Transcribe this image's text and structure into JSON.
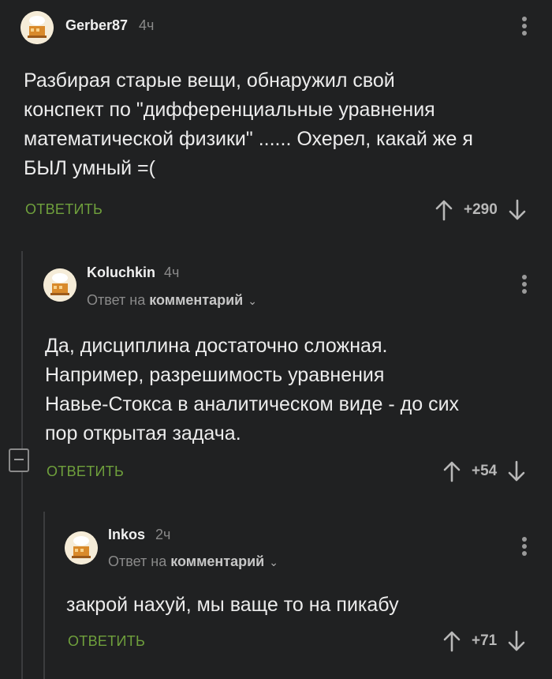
{
  "comments": [
    {
      "username": "Gerber87",
      "time": "4ч",
      "text": "Разбирая старые вещи, обнаружил свой\nконспект по \"дифференциальные уравнения\nматематической физики\" ...... Охерел,  какай же я\nБЫЛ умный =(",
      "reply_label": "ОТВЕТИТЬ",
      "score": "+290"
    },
    {
      "username": "Koluchkin",
      "time": "4ч",
      "reply_prefix": "Ответ на",
      "reply_target": "комментарий",
      "text": "Да, дисциплина достаточно сложная.\nНапример, разрешимость уравнения\nНавье-Стокса в аналитическом виде - до сих\nпор открытая задача.",
      "reply_label": "ОТВЕТИТЬ",
      "score": "+54"
    },
    {
      "username": "Inkos",
      "time": "2ч",
      "reply_prefix": "Ответ на",
      "reply_target": "комментарий",
      "text": "закрой нахуй, мы ваще то на пикабу",
      "reply_label": "ОТВЕТИТЬ",
      "score": "+71"
    }
  ],
  "icons": {
    "avatar": "chef-hat-house-avatar",
    "menu": "vertical-dots-icon",
    "upvote": "arrow-up-icon",
    "downvote": "arrow-down-icon",
    "collapse": "minus-square-icon"
  },
  "colors": {
    "background": "#202122",
    "accent_green": "#6fa03c",
    "muted": "#8a8a8a"
  }
}
